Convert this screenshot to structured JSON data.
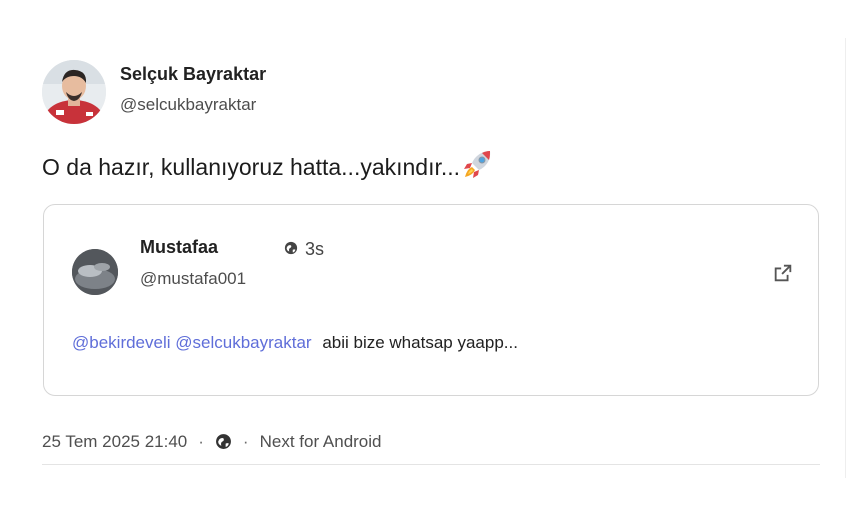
{
  "author": {
    "name": "Selçuk Bayraktar",
    "handle": "@selcukbayraktar",
    "avatar_icon": "profile-photo"
  },
  "post": {
    "text": "O da hazır, kullanıyoruz hatta...yakındır...",
    "emoji_icon": "rocket-icon"
  },
  "quote": {
    "name": "Mustafaa",
    "handle": "@mustafa001",
    "time": "3s",
    "visibility_icon": "globe-icon",
    "open_icon": "open-external-icon",
    "mentions": [
      "@bekirdeveli",
      "@selcukbayraktar"
    ],
    "text": "abii bize whatsap yaapp..."
  },
  "footer": {
    "date": "25 Tem 2025 21:40",
    "separator": "·",
    "visibility_icon": "globe-icon",
    "client": "Next for Android"
  },
  "colors": {
    "mention": "#5f6ed9",
    "border": "#d6d6d6",
    "text": "#1c1c1c",
    "muted": "#4f4f4f"
  }
}
